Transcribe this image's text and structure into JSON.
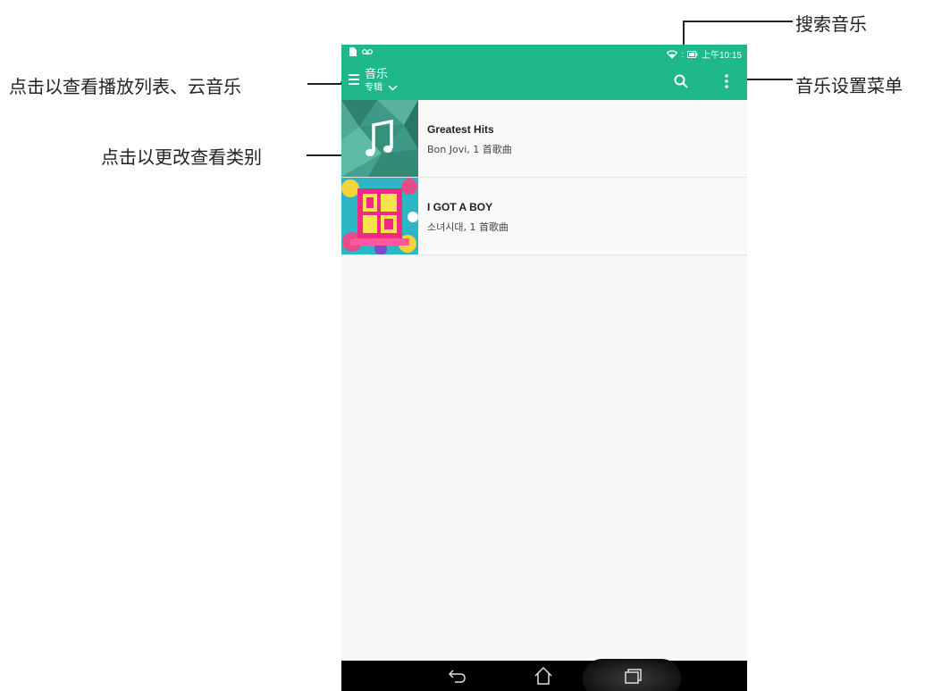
{
  "status_bar": {
    "time": "上午10:15",
    "left_icons": [
      "file-icon",
      "voicemail-icon"
    ],
    "right_icons": [
      "wifi-icon",
      "battery-icon"
    ]
  },
  "app_bar": {
    "title": "音乐",
    "subtitle": "专辑"
  },
  "albums": [
    {
      "title": "Greatest Hits",
      "subtitle": "Bon Jovi, 1 首歌曲"
    },
    {
      "title": "I GOT A BOY",
      "subtitle": "소녀시대, 1 首歌曲"
    }
  ],
  "annotations": {
    "menu": "点击以查看播放列表、云音乐",
    "category": "点击以更改查看类别",
    "search": "搜索音乐",
    "settings": "音乐设置菜单"
  },
  "colors": {
    "accent": "#1fb88a",
    "navbar": "#000000"
  }
}
